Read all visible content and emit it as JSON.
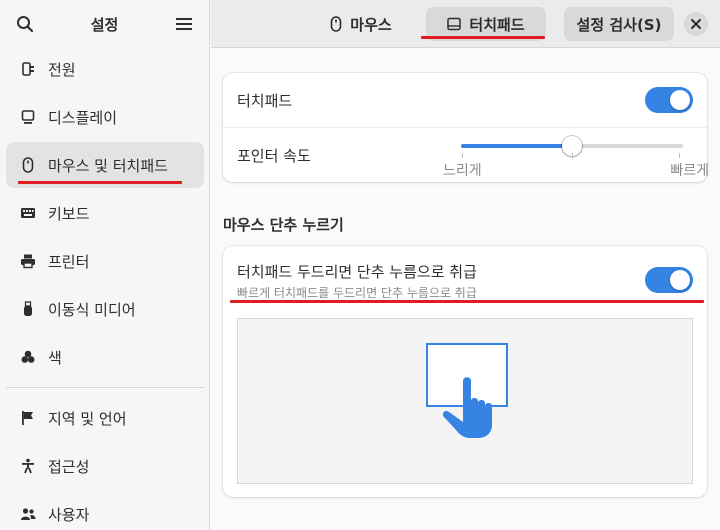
{
  "sidebar": {
    "title": "설정",
    "items": [
      {
        "label": "전원",
        "icon": "power-plug-icon"
      },
      {
        "label": "디스플레이",
        "icon": "display-icon"
      },
      {
        "label": "마우스 및 터치패드",
        "icon": "mouse-icon"
      },
      {
        "label": "키보드",
        "icon": "keyboard-icon"
      },
      {
        "label": "프린터",
        "icon": "printer-icon"
      },
      {
        "label": "이동식 미디어",
        "icon": "usb-icon"
      },
      {
        "label": "색",
        "icon": "color-icon"
      },
      {
        "label": "지역 및 언어",
        "icon": "flag-icon"
      },
      {
        "label": "접근성",
        "icon": "accessibility-icon"
      },
      {
        "label": "사용자",
        "icon": "users-icon"
      }
    ]
  },
  "header": {
    "tabs": [
      {
        "label": "마우스",
        "icon": "mouse-icon"
      },
      {
        "label": "터치패드",
        "icon": "touchpad-icon"
      }
    ],
    "test_button": "설정 검사(S)"
  },
  "touchpad": {
    "toggle_label": "터치패드",
    "toggle_on": true,
    "pointer_speed_label": "포인터 속도",
    "pointer_speed_value": 0.5,
    "slow_label": "느리게",
    "fast_label": "빠르게"
  },
  "click": {
    "section_title": "마우스 단추 누르기",
    "tap_label": "터치패드 두드리면 단추 누름으로 취급",
    "tap_sub": "빠르게 터치패드를 두드리면 단추 누름으로 취급",
    "tap_on": true
  },
  "colors": {
    "accent": "#3584e4",
    "highlight": "#e01b24"
  }
}
